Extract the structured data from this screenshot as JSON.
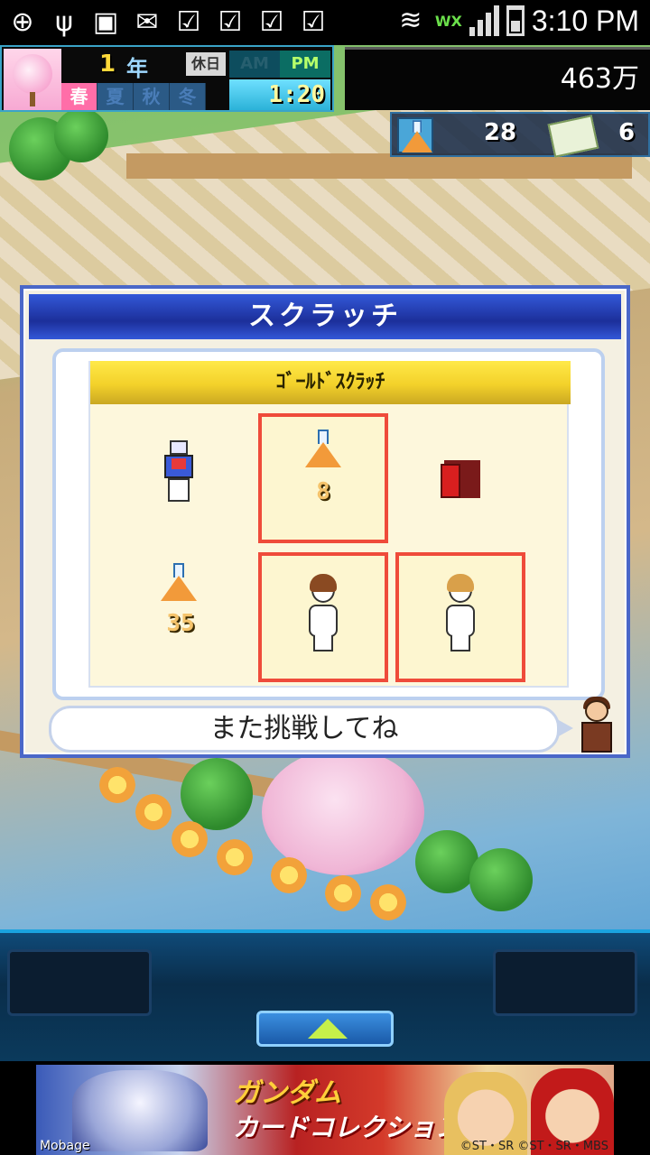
{
  "status_bar": {
    "time": "3:10 PM",
    "network_label": "WX",
    "icons": [
      "add-icon",
      "usb-icon",
      "image-icon",
      "mail-icon",
      "check-icon",
      "check-icon",
      "check-icon",
      "check-icon",
      "no-signal-icon",
      "wifi-icon",
      "signal-icon",
      "battery-icon"
    ]
  },
  "hud": {
    "year": "1",
    "year_unit": "年",
    "holiday": "休日",
    "seasons": [
      "春",
      "夏",
      "秋",
      "冬"
    ],
    "active_season": "春",
    "am_label": "AM",
    "pm_label": "PM",
    "active_period": "PM",
    "clock": "1:20",
    "money": "463万",
    "resource_flasks": "28",
    "resource_books": "6"
  },
  "dialog": {
    "title": "スクラッチ",
    "card_title": "ｺﾞｰﾙﾄﾞｽｸﾗｯﾁ",
    "cells": [
      {
        "item": "robot",
        "selected": false
      },
      {
        "item": "flask",
        "value": "8",
        "selected": true
      },
      {
        "item": "door",
        "selected": false
      },
      {
        "item": "flask",
        "value": "35",
        "selected": false
      },
      {
        "item": "person-brown-hair",
        "selected": true
      },
      {
        "item": "person-blond-hair",
        "selected": true
      }
    ],
    "message": "また挑戦してね"
  },
  "ad": {
    "brand": "Mobage",
    "title_line1": "ガンダム",
    "title_line2": "カードコレクション",
    "copyright": "©ST・SR ©ST・SR・MBS"
  },
  "colors": {
    "dialog_title_bg": "#1c2f9a",
    "selected_border": "#ef4b3a",
    "card_header": "#f3d12a",
    "bottom_bar": "#0a2d4a"
  }
}
